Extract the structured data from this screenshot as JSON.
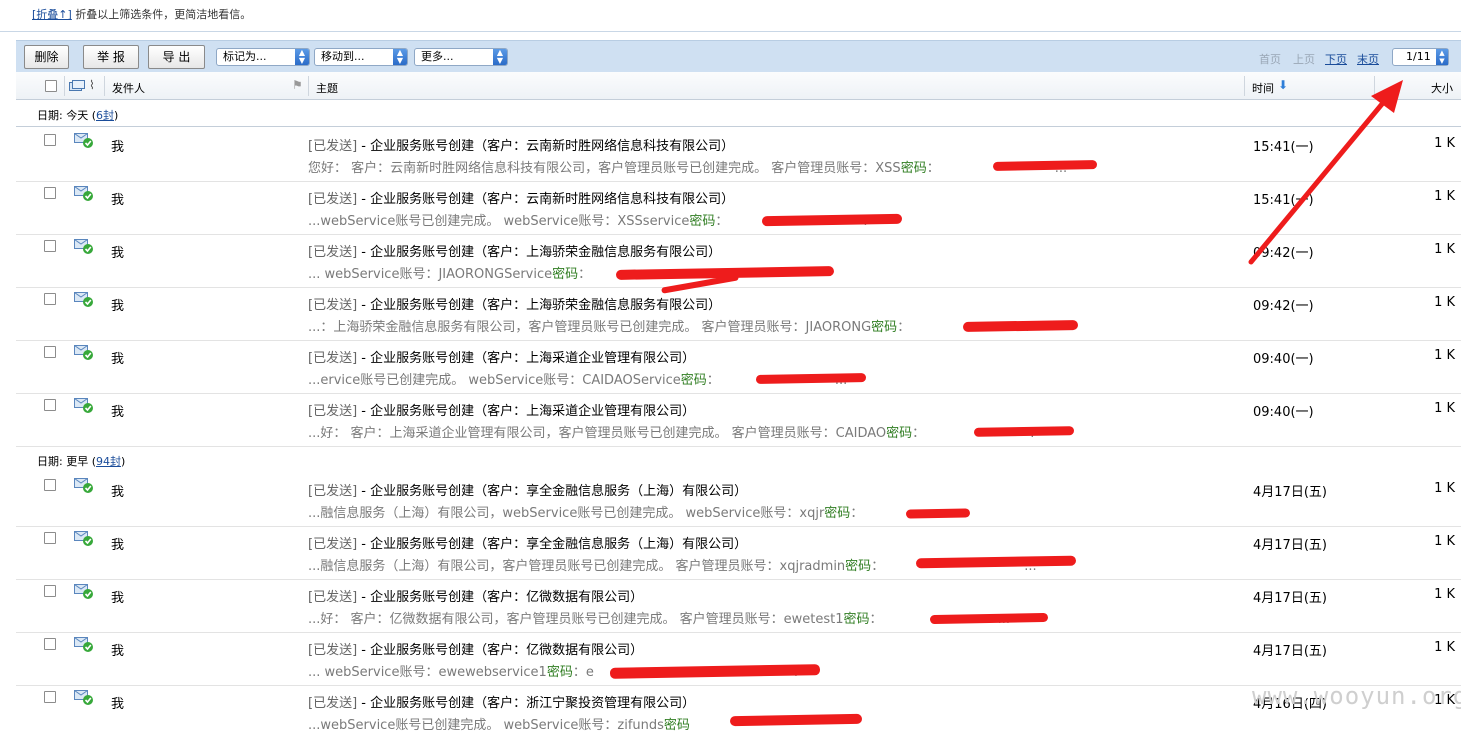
{
  "top_note": {
    "fold_link": "[折叠↑]",
    "text": "折叠以上筛选条件，更简洁地看信。"
  },
  "toolbar": {
    "delete_label": "删除",
    "report_label": "举 报",
    "export_label": "导 出",
    "mark_as": "标记为...",
    "move_to": "移动到...",
    "more": "更多...",
    "first_page": "首页",
    "prev_page": "上页",
    "next_page": "下页",
    "last_page": "末页",
    "page_value": "1/11"
  },
  "columns": {
    "sender": "发件人",
    "subject": "主题",
    "time": "时间",
    "size": "大小"
  },
  "groups": [
    {
      "label": "日期: 今天",
      "count": "6封"
    },
    {
      "label": "日期: 更早",
      "count": "94封"
    }
  ],
  "emails": [
    {
      "sender": "我",
      "tag": "[已发送]",
      "subject": " - 企业服务账号创建（客户：云南新时胜网络信息科技有限公司）",
      "preview_before": "您好： 客户：云南新时胜网络信息科技有限公司，客户管理员账号已创建完成。 客户管理员账号：XSS",
      "pw": "密码",
      "preview_after": "：",
      "tail": "...",
      "time": "15:41(一)",
      "size": "1 K"
    },
    {
      "sender": "我",
      "tag": "[已发送]",
      "subject": " - 企业服务账号创建（客户：云南新时胜网络信息科技有限公司）",
      "preview_before": "...webService账号已创建完成。 webService账号：XSSservice",
      "pw": "密码",
      "preview_after": "：",
      "tail": ".",
      "time": "15:41(一)",
      "size": "1 K"
    },
    {
      "sender": "我",
      "tag": "[已发送]",
      "subject": " - 企业服务账号创建（客户：上海骄荣金融信息服务有限公司）",
      "preview_before": "... webService账号：JIAORONGService",
      "pw": "密码",
      "preview_after": "：",
      "tail": "",
      "time": "09:42(一)",
      "size": "1 K"
    },
    {
      "sender": "我",
      "tag": "[已发送]",
      "subject": " - 企业服务账号创建（客户：上海骄荣金融信息服务有限公司）",
      "preview_before": "...：上海骄荣金融信息服务有限公司，客户管理员账号已创建完成。 客户管理员账号：JIAORONG",
      "pw": "密码",
      "preview_after": "：",
      "tail": ".",
      "time": "09:42(一)",
      "size": "1 K"
    },
    {
      "sender": "我",
      "tag": "[已发送]",
      "subject": " - 企业服务账号创建（客户：上海采道企业管理有限公司）",
      "preview_before": "...ervice账号已创建完成。 webService账号：CAIDAOService",
      "pw": "密码",
      "preview_after": "：",
      "tail": "...",
      "time": "09:40(一)",
      "size": "1 K"
    },
    {
      "sender": "我",
      "tag": "[已发送]",
      "subject": " - 企业服务账号创建（客户：上海采道企业管理有限公司）",
      "preview_before": "...好： 客户：上海采道企业管理有限公司，客户管理员账号已创建完成。 客户管理员账号：CAIDAO",
      "pw": "密码",
      "preview_after": "：",
      "tail": ".",
      "time": "09:40(一)",
      "size": "1 K"
    },
    {
      "sender": "我",
      "tag": "[已发送]",
      "subject": " - 企业服务账号创建（客户：享全金融信息服务（上海）有限公司）",
      "preview_before": "...融信息服务（上海）有限公司，webService账号已创建完成。 webService账号：xqjr",
      "pw": "密码",
      "preview_after": "：",
      "tail": "",
      "time": "4月17日(五)",
      "size": "1 K"
    },
    {
      "sender": "我",
      "tag": "[已发送]",
      "subject": " - 企业服务账号创建（客户：享全金融信息服务（上海）有限公司）",
      "preview_before": "...融信息服务（上海）有限公司，客户管理员账号已创建完成。 客户管理员账号：xqjradmin",
      "pw": "密码",
      "preview_after": "：",
      "tail": "...",
      "time": "4月17日(五)",
      "size": "1 K"
    },
    {
      "sender": "我",
      "tag": "[已发送]",
      "subject": " - 企业服务账号创建（客户：亿微数据有限公司）",
      "preview_before": "...好： 客户：亿微数据有限公司，客户管理员账号已创建完成。 客户管理员账号：ewetest1",
      "pw": "密码",
      "preview_after": "：",
      "tail": "...",
      "time": "4月17日(五)",
      "size": "1 K"
    },
    {
      "sender": "我",
      "tag": "[已发送]",
      "subject": " - 企业服务账号创建（客户：亿微数据有限公司）",
      "preview_before": "... webService账号：ewewebservice1",
      "pw": "密码",
      "preview_after": "：e",
      "tail": ".",
      "time": "4月17日(五)",
      "size": "1 K"
    },
    {
      "sender": "我",
      "tag": "[已发送]",
      "subject": " - 企业服务账号创建（客户：浙江宁聚投资管理有限公司）",
      "preview_before": "...webService账号已创建完成。 webService账号：zifunds",
      "pw": "密码",
      "preview_after": "",
      "tail": "",
      "time": "4月16日(四)",
      "size": "1 K"
    }
  ],
  "watermark": "www.wooyun.org",
  "colors": {
    "toolbar_bg": "#cfe0f2",
    "link": "#1a4c9a",
    "password_green": "#2f7d21",
    "redaction": "#ee1c1c",
    "annotation_arrow": "#ee1c1c"
  }
}
